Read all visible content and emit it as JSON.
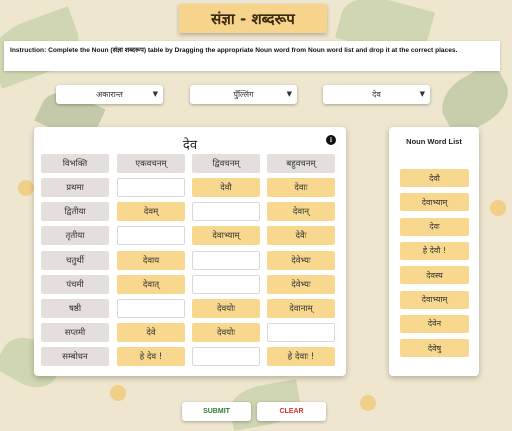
{
  "title": "संज्ञा - शब्दरूप",
  "instruction": "Instruction: Complete the Noun (संज्ञा शब्दरूप) table by Dragging the appropriate Noun word from Noun word list and drop it at the correct places.",
  "selects": [
    {
      "value": "अकारान्त"
    },
    {
      "value": "पुँल्लिंग"
    },
    {
      "value": "देव"
    }
  ],
  "table": {
    "title": "देव",
    "headers": [
      "विभक्ति",
      "एकवचनम्",
      "द्विवचनम्",
      "बहुवचनम्"
    ],
    "rows": [
      {
        "label": "प्रथमा",
        "cells": [
          "",
          "देवौ",
          "देवाः"
        ]
      },
      {
        "label": "द्वितीया",
        "cells": [
          "देवम्",
          "",
          "देवान्"
        ]
      },
      {
        "label": "तृतीया",
        "cells": [
          "",
          "देवाभ्याम्",
          "देवैः"
        ]
      },
      {
        "label": "चतुर्थी",
        "cells": [
          "देवाय",
          "",
          "देवेभ्यः"
        ]
      },
      {
        "label": "पंचमी",
        "cells": [
          "देवात्",
          "",
          "देवेभ्यः"
        ]
      },
      {
        "label": "षष्ठी",
        "cells": [
          "",
          "देवयोः",
          "देवानाम्"
        ]
      },
      {
        "label": "सप्तमी",
        "cells": [
          "देवे",
          "देवयोः",
          ""
        ]
      },
      {
        "label": "सम्बोधन",
        "cells": [
          "हे देव !",
          "",
          "हे देवाः !"
        ]
      }
    ]
  },
  "word_list": {
    "title": "Noun Word List",
    "words": [
      "देवौ",
      "देवाभ्याम्",
      "देवः",
      "हे देवौ !",
      "देवस्य",
      "देवाभ्याम्",
      "देवेन",
      "देवेषु"
    ]
  },
  "buttons": {
    "submit": "SUBMIT",
    "clear": "CLEAR"
  },
  "colors": {
    "tile": "#f8d88f",
    "submit": "#2e7d32",
    "clear": "#d32f2f",
    "background": "#efe6cf"
  }
}
